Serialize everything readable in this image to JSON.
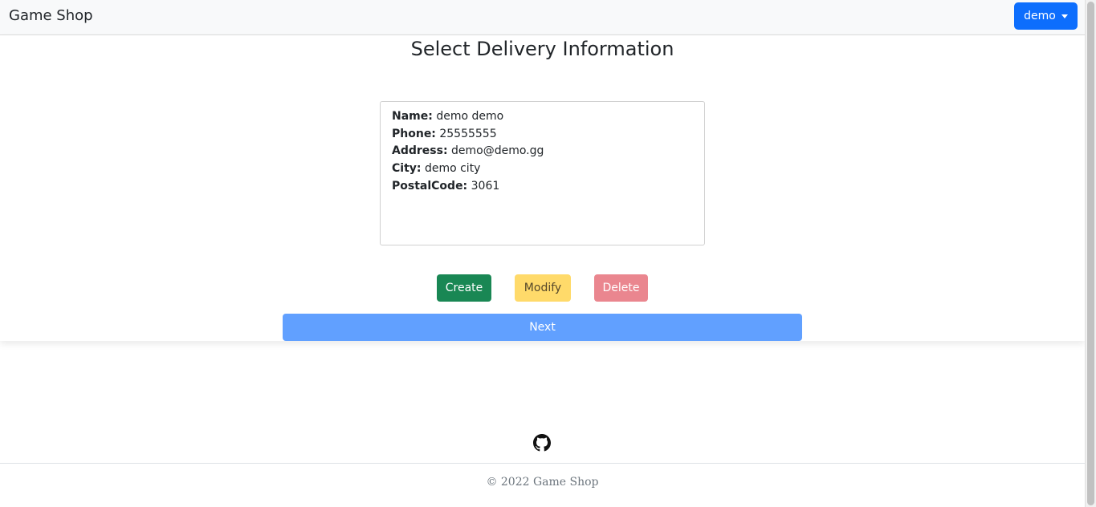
{
  "navbar": {
    "brand": "Game Shop",
    "user_label": "demo"
  },
  "main": {
    "title": "Select Delivery Information",
    "delivery": {
      "name_label": "Name:",
      "name": "demo demo",
      "phone_label": "Phone:",
      "phone": "25555555",
      "address_label": "Address:",
      "address": "demo@demo.gg",
      "city_label": "City:",
      "city": "demo city",
      "postal_label": "PostalCode:",
      "postal": "3061"
    },
    "buttons": {
      "create": "Create",
      "modify": "Modify",
      "delete": "Delete",
      "next": "Next"
    }
  },
  "footer": {
    "icon": "github-icon",
    "copyright": "© 2022 Game Shop"
  },
  "colors": {
    "primary": "#0d6efd",
    "success": "#198754",
    "warning_light": "#ffda6a",
    "danger_light": "#ea868f",
    "primary_light": "#61a0ff"
  }
}
